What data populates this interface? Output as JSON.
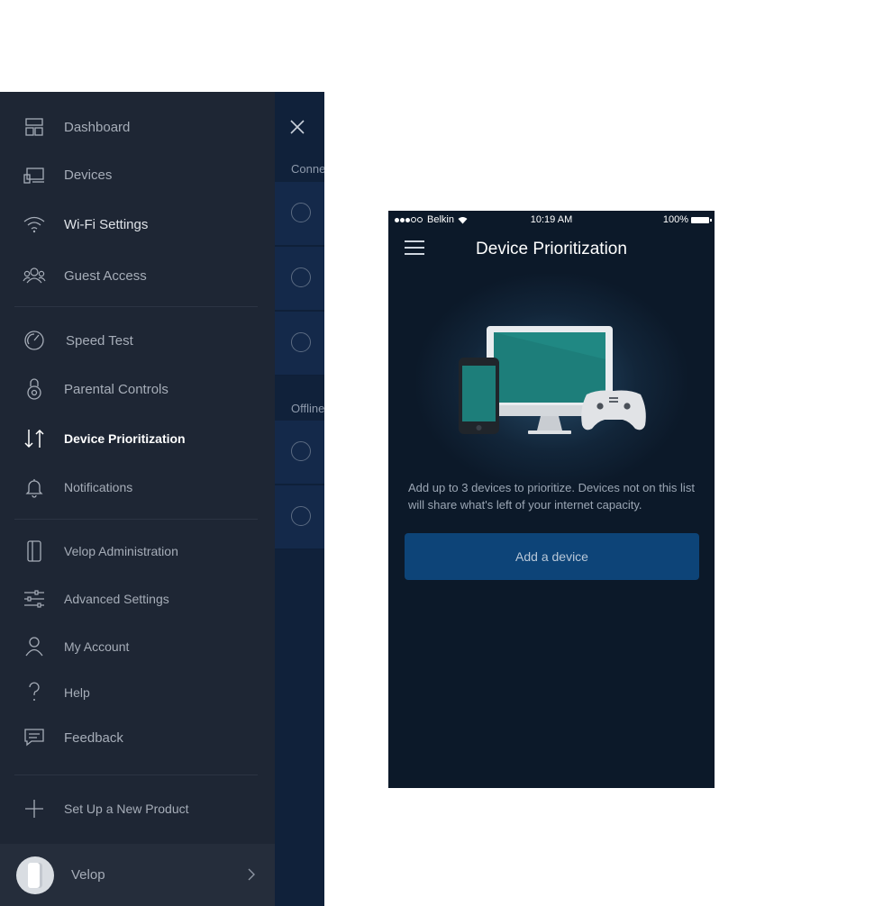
{
  "behind_panel": {
    "section_connected": "Conne",
    "section_offline": "Offline"
  },
  "menu": {
    "items": [
      {
        "label": "Dashboard",
        "icon": "dashboard-icon"
      },
      {
        "label": "Devices",
        "icon": "devices-icon"
      },
      {
        "label": "Wi-Fi Settings",
        "icon": "wifi-icon"
      },
      {
        "label": "Guest Access",
        "icon": "guest-access-icon"
      },
      {
        "label": "Speed Test",
        "icon": "speedometer-icon"
      },
      {
        "label": "Parental Controls",
        "icon": "parental-controls-icon"
      },
      {
        "label": "Device Prioritization",
        "icon": "prioritization-arrows-icon",
        "active": true
      },
      {
        "label": "Notifications",
        "icon": "bell-icon"
      },
      {
        "label": "Velop Administration",
        "icon": "velop-node-icon"
      },
      {
        "label": "Advanced Settings",
        "icon": "sliders-icon"
      },
      {
        "label": "My Account",
        "icon": "user-icon"
      },
      {
        "label": "Help",
        "icon": "question-icon"
      },
      {
        "label": "Feedback",
        "icon": "feedback-icon"
      },
      {
        "label": "Set Up a New Product",
        "icon": "plus-icon"
      }
    ],
    "account": {
      "label": "Velop"
    }
  },
  "phone": {
    "status": {
      "carrier": "Belkin",
      "time": "10:19 AM",
      "battery": "100%"
    },
    "title": "Device Prioritization",
    "description": "Add up to 3 devices to prioritize. Devices not on this list will share what's left of your internet capacity.",
    "add_button": "Add a device"
  },
  "colors": {
    "sidebar_bg": "#1e2634",
    "phone_bg": "#0c1929",
    "button_bg": "#0d4478",
    "screen_teal": "#1d7e7a"
  }
}
